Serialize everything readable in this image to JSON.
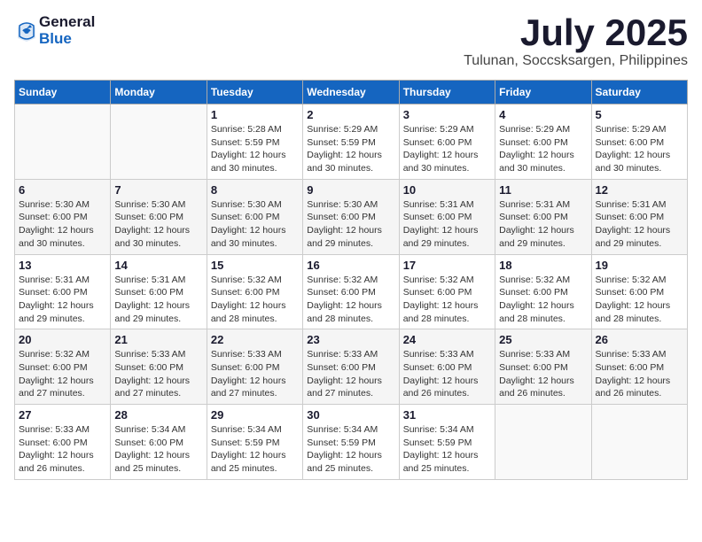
{
  "header": {
    "logo_general": "General",
    "logo_blue": "Blue",
    "month": "July 2025",
    "location": "Tulunan, Soccsksargen, Philippines"
  },
  "weekdays": [
    "Sunday",
    "Monday",
    "Tuesday",
    "Wednesday",
    "Thursday",
    "Friday",
    "Saturday"
  ],
  "weeks": [
    [
      {
        "day": "",
        "sunrise": "",
        "sunset": "",
        "daylight": ""
      },
      {
        "day": "",
        "sunrise": "",
        "sunset": "",
        "daylight": ""
      },
      {
        "day": "1",
        "sunrise": "Sunrise: 5:28 AM",
        "sunset": "Sunset: 5:59 PM",
        "daylight": "Daylight: 12 hours and 30 minutes."
      },
      {
        "day": "2",
        "sunrise": "Sunrise: 5:29 AM",
        "sunset": "Sunset: 5:59 PM",
        "daylight": "Daylight: 12 hours and 30 minutes."
      },
      {
        "day": "3",
        "sunrise": "Sunrise: 5:29 AM",
        "sunset": "Sunset: 6:00 PM",
        "daylight": "Daylight: 12 hours and 30 minutes."
      },
      {
        "day": "4",
        "sunrise": "Sunrise: 5:29 AM",
        "sunset": "Sunset: 6:00 PM",
        "daylight": "Daylight: 12 hours and 30 minutes."
      },
      {
        "day": "5",
        "sunrise": "Sunrise: 5:29 AM",
        "sunset": "Sunset: 6:00 PM",
        "daylight": "Daylight: 12 hours and 30 minutes."
      }
    ],
    [
      {
        "day": "6",
        "sunrise": "Sunrise: 5:30 AM",
        "sunset": "Sunset: 6:00 PM",
        "daylight": "Daylight: 12 hours and 30 minutes."
      },
      {
        "day": "7",
        "sunrise": "Sunrise: 5:30 AM",
        "sunset": "Sunset: 6:00 PM",
        "daylight": "Daylight: 12 hours and 30 minutes."
      },
      {
        "day": "8",
        "sunrise": "Sunrise: 5:30 AM",
        "sunset": "Sunset: 6:00 PM",
        "daylight": "Daylight: 12 hours and 30 minutes."
      },
      {
        "day": "9",
        "sunrise": "Sunrise: 5:30 AM",
        "sunset": "Sunset: 6:00 PM",
        "daylight": "Daylight: 12 hours and 29 minutes."
      },
      {
        "day": "10",
        "sunrise": "Sunrise: 5:31 AM",
        "sunset": "Sunset: 6:00 PM",
        "daylight": "Daylight: 12 hours and 29 minutes."
      },
      {
        "day": "11",
        "sunrise": "Sunrise: 5:31 AM",
        "sunset": "Sunset: 6:00 PM",
        "daylight": "Daylight: 12 hours and 29 minutes."
      },
      {
        "day": "12",
        "sunrise": "Sunrise: 5:31 AM",
        "sunset": "Sunset: 6:00 PM",
        "daylight": "Daylight: 12 hours and 29 minutes."
      }
    ],
    [
      {
        "day": "13",
        "sunrise": "Sunrise: 5:31 AM",
        "sunset": "Sunset: 6:00 PM",
        "daylight": "Daylight: 12 hours and 29 minutes."
      },
      {
        "day": "14",
        "sunrise": "Sunrise: 5:31 AM",
        "sunset": "Sunset: 6:00 PM",
        "daylight": "Daylight: 12 hours and 29 minutes."
      },
      {
        "day": "15",
        "sunrise": "Sunrise: 5:32 AM",
        "sunset": "Sunset: 6:00 PM",
        "daylight": "Daylight: 12 hours and 28 minutes."
      },
      {
        "day": "16",
        "sunrise": "Sunrise: 5:32 AM",
        "sunset": "Sunset: 6:00 PM",
        "daylight": "Daylight: 12 hours and 28 minutes."
      },
      {
        "day": "17",
        "sunrise": "Sunrise: 5:32 AM",
        "sunset": "Sunset: 6:00 PM",
        "daylight": "Daylight: 12 hours and 28 minutes."
      },
      {
        "day": "18",
        "sunrise": "Sunrise: 5:32 AM",
        "sunset": "Sunset: 6:00 PM",
        "daylight": "Daylight: 12 hours and 28 minutes."
      },
      {
        "day": "19",
        "sunrise": "Sunrise: 5:32 AM",
        "sunset": "Sunset: 6:00 PM",
        "daylight": "Daylight: 12 hours and 28 minutes."
      }
    ],
    [
      {
        "day": "20",
        "sunrise": "Sunrise: 5:32 AM",
        "sunset": "Sunset: 6:00 PM",
        "daylight": "Daylight: 12 hours and 27 minutes."
      },
      {
        "day": "21",
        "sunrise": "Sunrise: 5:33 AM",
        "sunset": "Sunset: 6:00 PM",
        "daylight": "Daylight: 12 hours and 27 minutes."
      },
      {
        "day": "22",
        "sunrise": "Sunrise: 5:33 AM",
        "sunset": "Sunset: 6:00 PM",
        "daylight": "Daylight: 12 hours and 27 minutes."
      },
      {
        "day": "23",
        "sunrise": "Sunrise: 5:33 AM",
        "sunset": "Sunset: 6:00 PM",
        "daylight": "Daylight: 12 hours and 27 minutes."
      },
      {
        "day": "24",
        "sunrise": "Sunrise: 5:33 AM",
        "sunset": "Sunset: 6:00 PM",
        "daylight": "Daylight: 12 hours and 26 minutes."
      },
      {
        "day": "25",
        "sunrise": "Sunrise: 5:33 AM",
        "sunset": "Sunset: 6:00 PM",
        "daylight": "Daylight: 12 hours and 26 minutes."
      },
      {
        "day": "26",
        "sunrise": "Sunrise: 5:33 AM",
        "sunset": "Sunset: 6:00 PM",
        "daylight": "Daylight: 12 hours and 26 minutes."
      }
    ],
    [
      {
        "day": "27",
        "sunrise": "Sunrise: 5:33 AM",
        "sunset": "Sunset: 6:00 PM",
        "daylight": "Daylight: 12 hours and 26 minutes."
      },
      {
        "day": "28",
        "sunrise": "Sunrise: 5:34 AM",
        "sunset": "Sunset: 6:00 PM",
        "daylight": "Daylight: 12 hours and 25 minutes."
      },
      {
        "day": "29",
        "sunrise": "Sunrise: 5:34 AM",
        "sunset": "Sunset: 5:59 PM",
        "daylight": "Daylight: 12 hours and 25 minutes."
      },
      {
        "day": "30",
        "sunrise": "Sunrise: 5:34 AM",
        "sunset": "Sunset: 5:59 PM",
        "daylight": "Daylight: 12 hours and 25 minutes."
      },
      {
        "day": "31",
        "sunrise": "Sunrise: 5:34 AM",
        "sunset": "Sunset: 5:59 PM",
        "daylight": "Daylight: 12 hours and 25 minutes."
      },
      {
        "day": "",
        "sunrise": "",
        "sunset": "",
        "daylight": ""
      },
      {
        "day": "",
        "sunrise": "",
        "sunset": "",
        "daylight": ""
      }
    ]
  ]
}
